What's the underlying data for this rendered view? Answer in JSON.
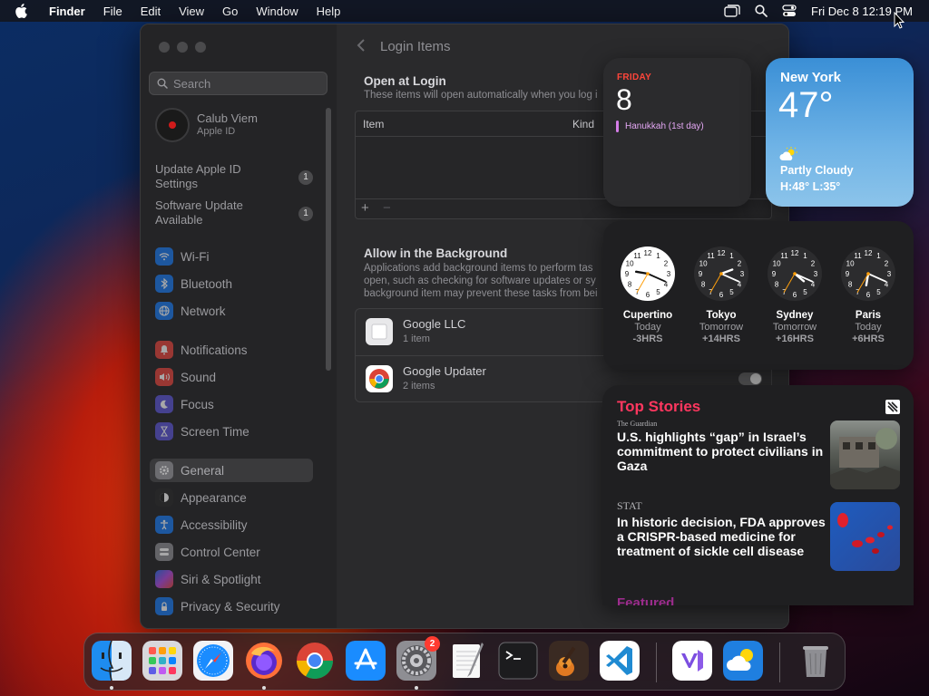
{
  "menubar": {
    "app": "Finder",
    "items": [
      "File",
      "Edit",
      "View",
      "Go",
      "Window",
      "Help"
    ],
    "clock": "Fri Dec 8  12:19 PM",
    "icons": [
      "apple-icon",
      "window-icon",
      "search-icon",
      "control-center-icon"
    ]
  },
  "sidebar": {
    "search_placeholder": "Search",
    "user": {
      "name": "Calub Viem",
      "subtitle": "Apple ID"
    },
    "notices": [
      {
        "label": "Update Apple ID Settings",
        "badge": "1"
      },
      {
        "label": "Software Update Available",
        "badge": "1"
      }
    ],
    "items": [
      {
        "label": "Wi-Fi",
        "icon": "wifi-icon",
        "color": "#1a7af0"
      },
      {
        "label": "Bluetooth",
        "icon": "bluetooth-icon",
        "color": "#1a7af0"
      },
      {
        "label": "Network",
        "icon": "network-icon",
        "color": "#1a7af0"
      },
      {
        "label": "Notifications",
        "icon": "notifications-icon",
        "color": "#e8453c"
      },
      {
        "label": "Sound",
        "icon": "sound-icon",
        "color": "#e8453c"
      },
      {
        "label": "Focus",
        "icon": "focus-icon",
        "color": "#5b55d6"
      },
      {
        "label": "Screen Time",
        "icon": "screen-time-icon",
        "color": "#5b55d6"
      },
      {
        "label": "General",
        "icon": "general-icon",
        "color": "#8e8e93"
      },
      {
        "label": "Appearance",
        "icon": "appearance-icon",
        "color": "#2a2a2a"
      },
      {
        "label": "Accessibility",
        "icon": "accessibility-icon",
        "color": "#1a7af0"
      },
      {
        "label": "Control Center",
        "icon": "control-center-icon",
        "color": "#8e8e93"
      },
      {
        "label": "Siri & Spotlight",
        "icon": "siri-icon",
        "color": "#b04ae0"
      },
      {
        "label": "Privacy & Security",
        "icon": "privacy-icon",
        "color": "#1a7af0"
      }
    ],
    "selected": "General"
  },
  "content": {
    "title": "Login Items",
    "open_at_login": {
      "title": "Open at Login",
      "desc": "These items will open automatically when you log i",
      "columns": [
        "Item",
        "Kind"
      ],
      "add": "+",
      "remove": "−"
    },
    "background": {
      "title": "Allow in the Background",
      "desc_lines": [
        "Applications add background items to perform tas",
        "open, such as checking for software updates or sy",
        "background item may prevent these tasks from bei"
      ],
      "items": [
        {
          "name": "Google LLC",
          "count": "1 item"
        },
        {
          "name": "Google Updater",
          "count": "2 items"
        }
      ]
    }
  },
  "widgets": {
    "calendar": {
      "weekday": "FRIDAY",
      "date": "8",
      "event": "Hanukkah (1st day)"
    },
    "weather": {
      "city": "New York",
      "temp": "47°",
      "condition": "Partly Cloudy",
      "hilo": "H:48° L:35°"
    },
    "clocks": [
      {
        "city": "Cupertino",
        "day": "Today",
        "offset": "-3HRS",
        "time": "9:19",
        "light": true
      },
      {
        "city": "Tokyo",
        "day": "Tomorrow",
        "offset": "+14HRS",
        "time": "2:19",
        "light": false
      },
      {
        "city": "Sydney",
        "day": "Tomorrow",
        "offset": "+16HRS",
        "time": "4:19",
        "light": false
      },
      {
        "city": "Paris",
        "day": "Today",
        "offset": "+6HRS",
        "time": "6:19",
        "light": false
      }
    ],
    "news": {
      "header": "Top Stories",
      "stories": [
        {
          "source": "The Guardian",
          "headline": "U.S. highlights “gap” in Israel’s commitment to protect civilians in Gaza"
        },
        {
          "source": "STAT",
          "headline": "In historic decision, FDA approves a CRISPR-based medicine for treatment of sickle cell disease"
        }
      ],
      "featured": "Featured"
    }
  },
  "dock": {
    "apps": [
      "Finder",
      "Launchpad",
      "Safari",
      "Firefox",
      "Google Chrome",
      "App Store",
      "System Settings",
      "TextEdit",
      "Terminal",
      "GarageBand",
      "Visual Studio Code",
      "Visual Studio",
      "Weather",
      "Trash"
    ],
    "settings_badge": "2"
  }
}
